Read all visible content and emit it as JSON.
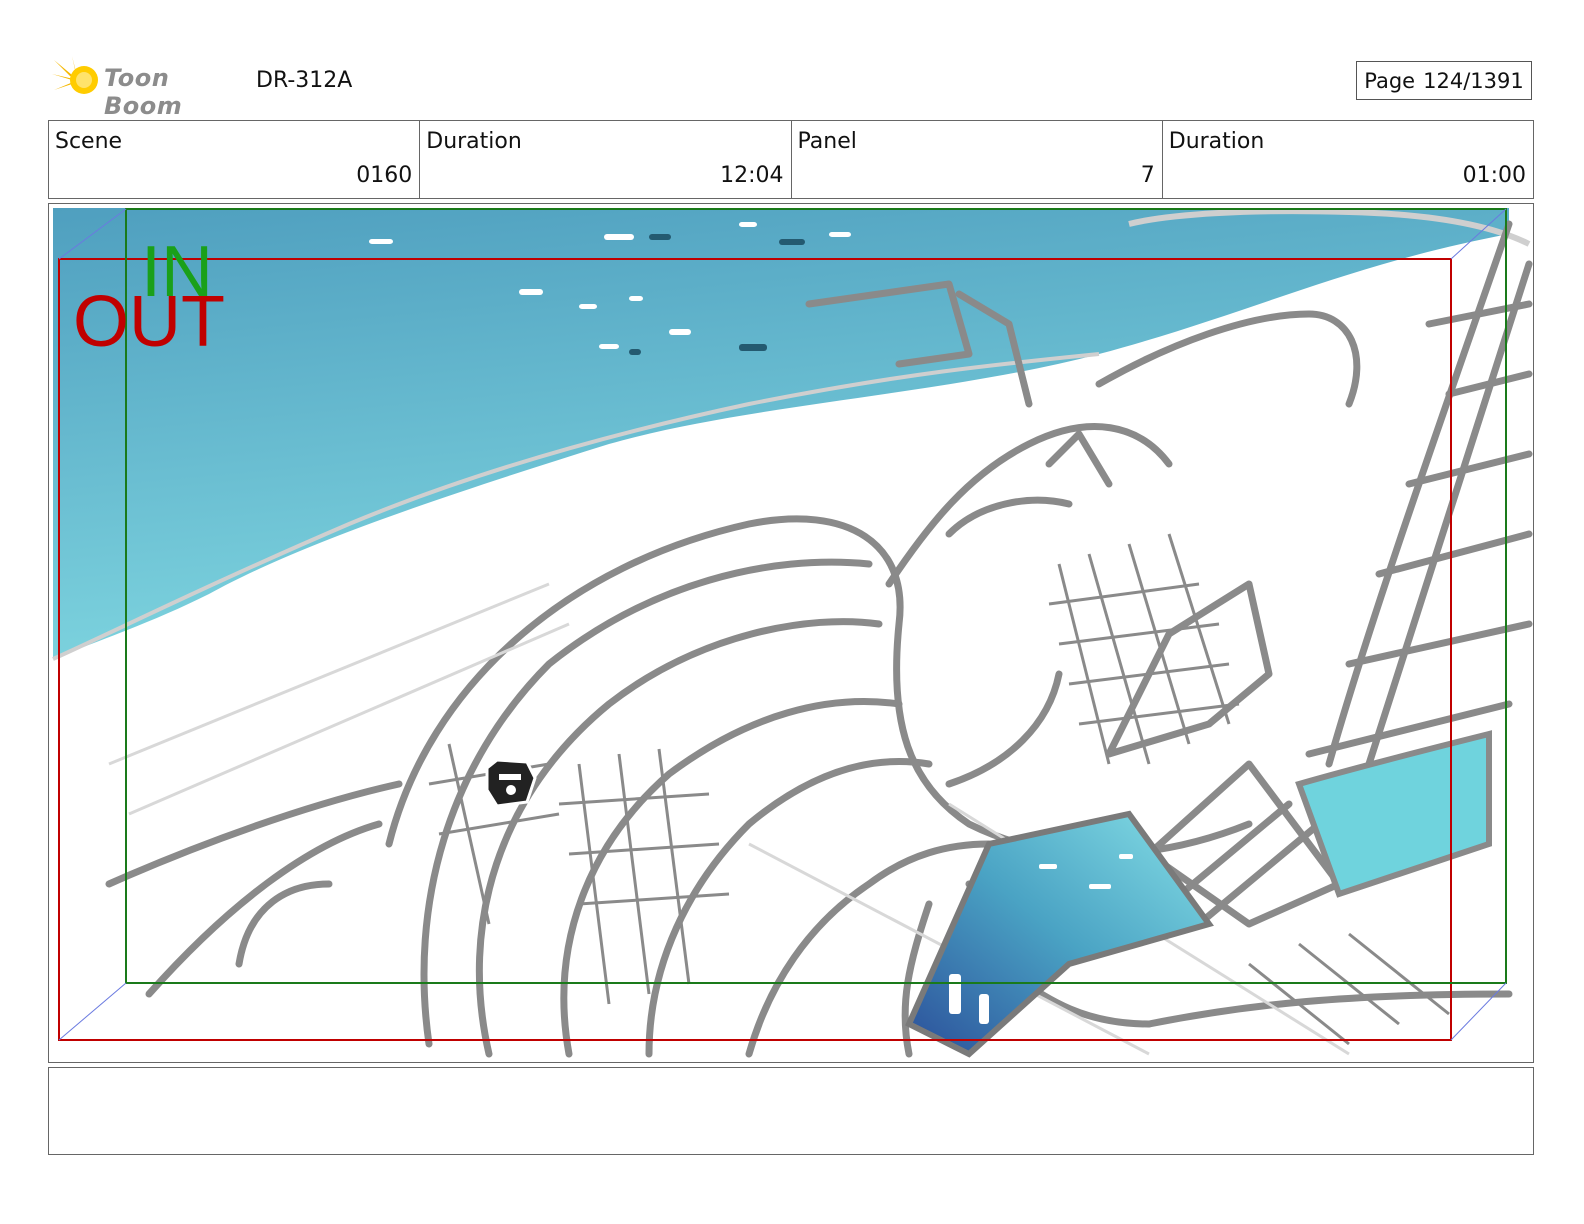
{
  "header": {
    "logo_text": "Toon Boom",
    "doc_code": "DR-312A",
    "page_label": "Page",
    "page_value": "124/1391"
  },
  "info": {
    "scene_label": "Scene",
    "scene_value": "0160",
    "scene_duration_label": "Duration",
    "scene_duration_value": "12:04",
    "panel_label": "Panel",
    "panel_value": "7",
    "panel_duration_label": "Duration",
    "panel_duration_value": "01:00"
  },
  "panel": {
    "in_label": "IN",
    "out_label": "OUT",
    "in_color": "#1aa01a",
    "out_color": "#c00000",
    "water_color": "#6cc7d6"
  },
  "caption": {
    "text": ""
  }
}
